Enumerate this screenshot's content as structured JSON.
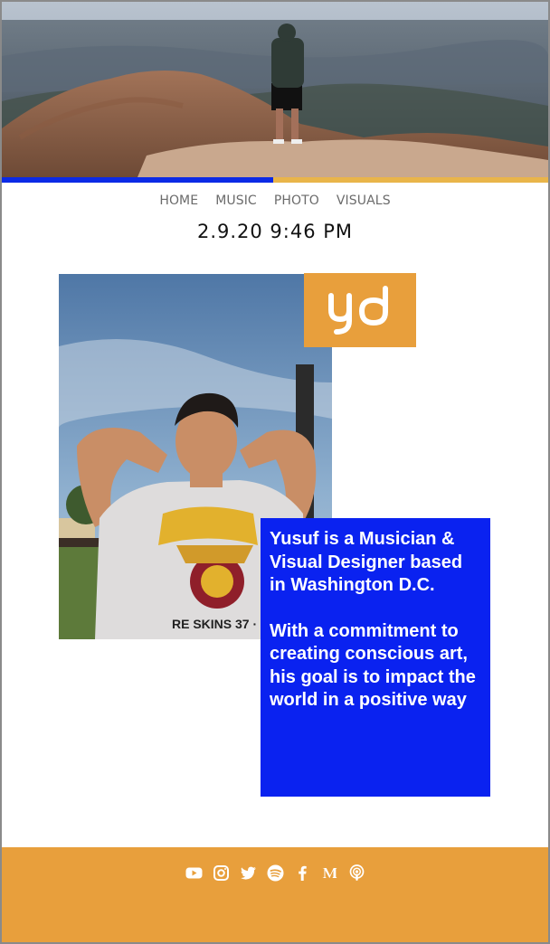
{
  "nav": {
    "items": [
      {
        "label": "HOME"
      },
      {
        "label": "MUSIC"
      },
      {
        "label": "PHOTO"
      },
      {
        "label": "VISUALS"
      }
    ]
  },
  "datetime": "2.9.20 9:46 PM",
  "logo": {
    "text": "yd"
  },
  "bio": {
    "paragraph1": "Yusuf is a Musician & Visual Designer based in Washington D.C.",
    "paragraph2": "With a commitment to creating conscious art, his goal is to impact the world in a positive way"
  },
  "footer": {
    "social_icons": [
      "youtube-icon",
      "instagram-icon",
      "twitter-icon",
      "spotify-icon",
      "facebook-icon",
      "medium-icon",
      "podcast-icon"
    ]
  },
  "colors": {
    "accent_orange": "#e89f3c",
    "accent_blue": "#0a22f0",
    "bar_yellow": "#e9b54a"
  }
}
